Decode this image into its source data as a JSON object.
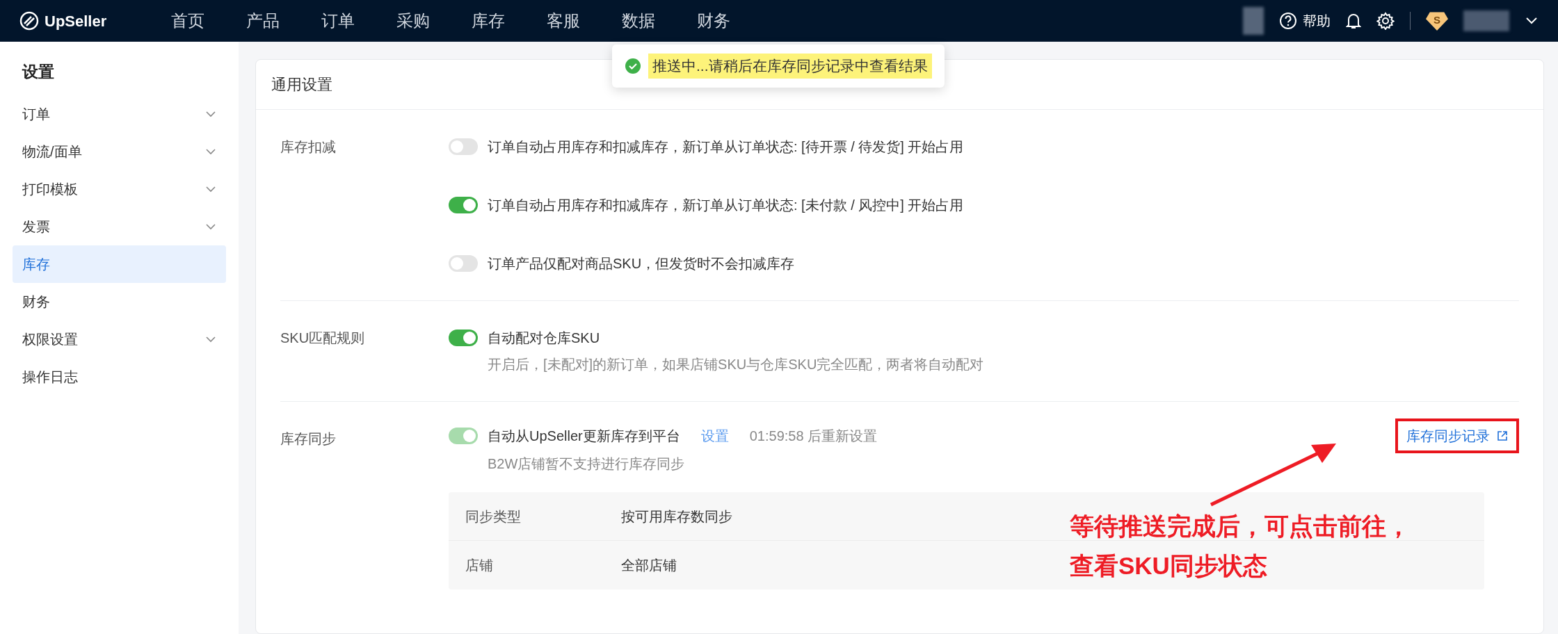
{
  "navbar": {
    "logo": "UpSeller",
    "items": [
      {
        "label": "首页",
        "selected": false
      },
      {
        "label": "产品",
        "selected": false
      },
      {
        "label": "订单",
        "selected": false
      },
      {
        "label": "采购",
        "selected": false
      },
      {
        "label": "库存",
        "selected": false
      },
      {
        "label": "客服",
        "selected": false
      },
      {
        "label": "数据",
        "selected": false
      },
      {
        "label": "财务",
        "selected": false
      }
    ],
    "help": "帮助",
    "badge": "S"
  },
  "toast": {
    "message": "推送中...请稍后在库存同步记录中查看结果"
  },
  "sidebar": {
    "title": "设置",
    "items": [
      {
        "label": "订单",
        "expandable": true,
        "selected": false
      },
      {
        "label": "物流/面单",
        "expandable": true,
        "selected": false
      },
      {
        "label": "打印模板",
        "expandable": true,
        "selected": false
      },
      {
        "label": "发票",
        "expandable": true,
        "selected": false
      },
      {
        "label": "库存",
        "expandable": false,
        "selected": true
      },
      {
        "label": "财务",
        "expandable": false,
        "selected": false
      },
      {
        "label": "权限设置",
        "expandable": true,
        "selected": false
      },
      {
        "label": "操作日志",
        "expandable": false,
        "selected": false
      }
    ]
  },
  "panel": {
    "title": "通用设置",
    "sections": [
      {
        "label": "库存扣减",
        "options": [
          {
            "text": "订单自动占用库存和扣减库存，新订单从订单状态: [待开票 / 待发货] 开始占用",
            "on": false,
            "disabled": false
          },
          {
            "text": "订单自动占用库存和扣减库存，新订单从订单状态: [未付款 / 风控中] 开始占用",
            "on": true,
            "disabled": false
          },
          {
            "text": "订单产品仅配对商品SKU，但发货时不会扣减库存",
            "on": false,
            "disabled": false
          }
        ]
      },
      {
        "label": "SKU匹配规则",
        "options": [
          {
            "text": "自动配对仓库SKU",
            "on": true,
            "disabled": false,
            "description": "开启后，[未配对]的新订单，如果店铺SKU与仓库SKU完全匹配，两者将自动配对"
          }
        ]
      },
      {
        "label": "库存同步",
        "options": [
          {
            "text": "自动从UpSeller更新库存到平台",
            "on": true,
            "disabled": true,
            "link": "设置",
            "note": "01:59:58 后重新设置",
            "description": "B2W店铺暂不支持进行库存同步"
          }
        ],
        "record_link": "库存同步记录",
        "details": [
          {
            "key": "同步类型",
            "value": "按可用库存数同步"
          },
          {
            "key": "店铺",
            "value": "全部店铺"
          }
        ]
      }
    ]
  },
  "annotation": {
    "lines": [
      "等待推送完成后，可点击前往，",
      "查看SKU同步状态"
    ]
  }
}
